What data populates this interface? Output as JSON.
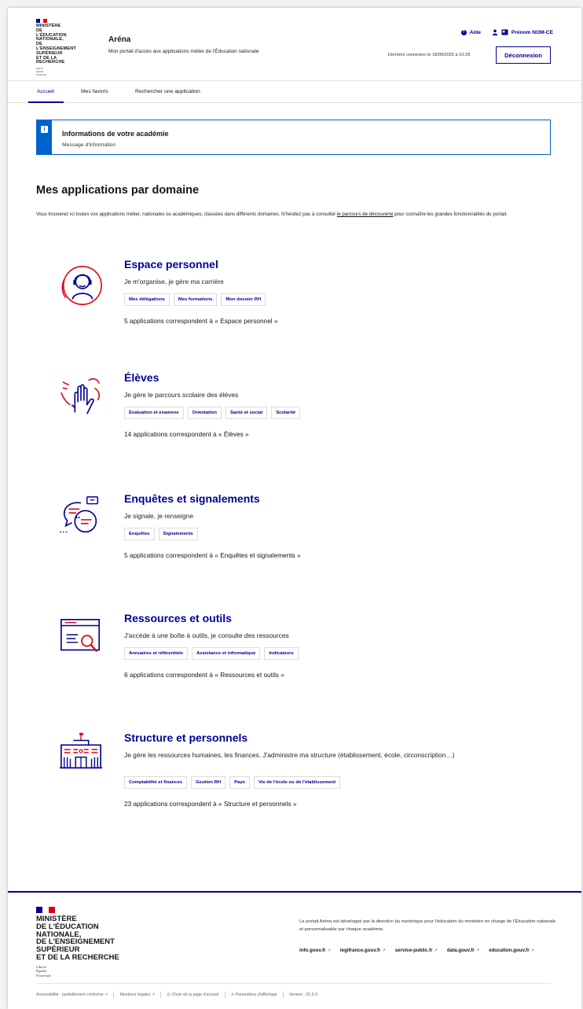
{
  "colors": {
    "accent": "#000091",
    "info": "#0063cb",
    "red": "#e1000f"
  },
  "header": {
    "ministry_lines": [
      "MINISTÈRE",
      "DE L'ÉDUCATION",
      "NATIONALE,",
      "DE L'ENSEIGNEMENT",
      "SUPÉRIEUR",
      "ET DE LA RECHERCHE"
    ],
    "devise": [
      "Liberté",
      "Égalité",
      "Fraternité"
    ],
    "app_title": "Aréna",
    "app_subtitle": "Mon portail d'accès aux applications métier de l'Éducation nationale",
    "help_label": "Aide",
    "user_label": "Prénom NOM-CE",
    "last_connection": "Dernière connexion le 18/09/2025 à 10:29",
    "logout_label": "Déconnexion"
  },
  "nav": {
    "items": [
      "Accueil",
      "Mes favoris",
      "Rechercher une application"
    ]
  },
  "info": {
    "title": "Informations de votre académie",
    "message": "Message d'information"
  },
  "section": {
    "title": "Mes applications par domaine",
    "intro_before": "Vous trouverez ici toutes vos applications métier, nationales ou académiques, classées dans différents domaines. N'hésitez pas à consulter ",
    "intro_link": "le parcours de découverte",
    "intro_after": " pour connaître les grandes fonctionnalités du portail."
  },
  "domains": [
    {
      "title": "Espace personnel",
      "icon": "user-headset-icon",
      "description": "Je m'organise, je gère ma carrière",
      "tags": [
        "Mes délégations",
        "Mes formations",
        "Mon dossier RH"
      ],
      "count": "5 applications correspondent à « Espace personnel »"
    },
    {
      "title": "Élèves",
      "icon": "raised-hand-icon",
      "description": "Je gère le parcours scolaire des élèves",
      "tags": [
        "Évaluation et examens",
        "Orientation",
        "Santé et social",
        "Scolarité"
      ],
      "count": "14 applications correspondent à « Élèves »"
    },
    {
      "title": "Enquêtes et signalements",
      "icon": "chat-bubbles-icon",
      "description": "Je signale, je renseigne",
      "tags": [
        "Enquêtes",
        "Signalements"
      ],
      "count": "5 applications correspondent à « Enquêtes et signalements »"
    },
    {
      "title": "Ressources et outils",
      "icon": "browser-search-icon",
      "description": "J'accède à une boîte à outils, je consulte des ressources",
      "tags": [
        "Annuaires et référentiels",
        "Assistance et informatique",
        "Indicateurs"
      ],
      "count": "6 applications correspondent à « Ressources et outils »"
    },
    {
      "title": "Structure et personnels",
      "icon": "school-building-icon",
      "description": "Je gère les ressources humaines, les finances. J'administre ma structure (établissement, école, circonscription…)",
      "tags": [
        "Comptabilité et finances",
        "Gestion RH",
        "Paye",
        "Vie de l'école ou de l'établissement"
      ],
      "count": "23 applications correspondent à « Structure et personnels »"
    }
  ],
  "footer": {
    "description": "Le portail Aréna est développé par la direction du numérique pour l'éducation du ministère en charge de l'Éducation nationale et personnalisable par chaque académie.",
    "links": [
      "info.gouv.fr",
      "legifrance.gouv.fr",
      "service-public.fr",
      "data.gouv.fr",
      "education.gouv.fr"
    ],
    "bottom": [
      "Accessibilité : partiellement conforme",
      "Mentions légales",
      "Choix de la page d'accueil",
      "Paramètres d'affichage",
      "Version : 25.5.0"
    ]
  }
}
